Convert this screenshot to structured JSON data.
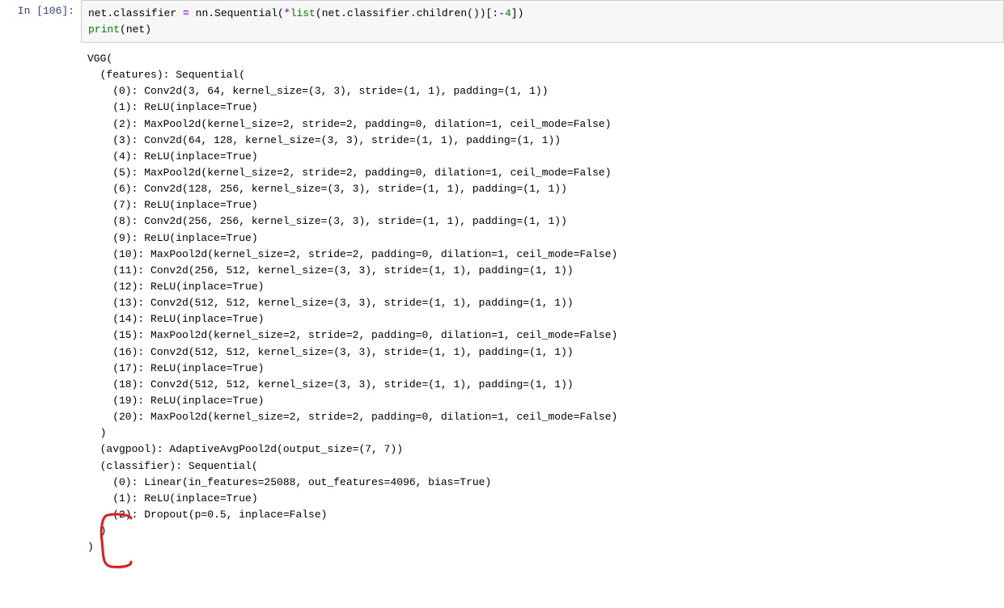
{
  "prompt": {
    "label": "In ",
    "number": "[106]:"
  },
  "code": {
    "line1": {
      "p1": "net.classifier ",
      "op": "=",
      "p2": " nn.Sequential(",
      "star": "*",
      "call": "list",
      "p3": "(net.classifier.children())[:",
      "neg": "-",
      "num": "4",
      "p4": "])"
    },
    "line2": {
      "fn": "print",
      "arg": "(net)"
    }
  },
  "output_lines": [
    "VGG(",
    "  (features): Sequential(",
    "    (0): Conv2d(3, 64, kernel_size=(3, 3), stride=(1, 1), padding=(1, 1))",
    "    (1): ReLU(inplace=True)",
    "    (2): MaxPool2d(kernel_size=2, stride=2, padding=0, dilation=1, ceil_mode=False)",
    "    (3): Conv2d(64, 128, kernel_size=(3, 3), stride=(1, 1), padding=(1, 1))",
    "    (4): ReLU(inplace=True)",
    "    (5): MaxPool2d(kernel_size=2, stride=2, padding=0, dilation=1, ceil_mode=False)",
    "    (6): Conv2d(128, 256, kernel_size=(3, 3), stride=(1, 1), padding=(1, 1))",
    "    (7): ReLU(inplace=True)",
    "    (8): Conv2d(256, 256, kernel_size=(3, 3), stride=(1, 1), padding=(1, 1))",
    "    (9): ReLU(inplace=True)",
    "    (10): MaxPool2d(kernel_size=2, stride=2, padding=0, dilation=1, ceil_mode=False)",
    "    (11): Conv2d(256, 512, kernel_size=(3, 3), stride=(1, 1), padding=(1, 1))",
    "    (12): ReLU(inplace=True)",
    "    (13): Conv2d(512, 512, kernel_size=(3, 3), stride=(1, 1), padding=(1, 1))",
    "    (14): ReLU(inplace=True)",
    "    (15): MaxPool2d(kernel_size=2, stride=2, padding=0, dilation=1, ceil_mode=False)",
    "    (16): Conv2d(512, 512, kernel_size=(3, 3), stride=(1, 1), padding=(1, 1))",
    "    (17): ReLU(inplace=True)",
    "    (18): Conv2d(512, 512, kernel_size=(3, 3), stride=(1, 1), padding=(1, 1))",
    "    (19): ReLU(inplace=True)",
    "    (20): MaxPool2d(kernel_size=2, stride=2, padding=0, dilation=1, ceil_mode=False)",
    "  )",
    "  (avgpool): AdaptiveAvgPool2d(output_size=(7, 7))",
    "  (classifier): Sequential(",
    "    (0): Linear(in_features=25088, out_features=4096, bias=True)",
    "    (1): ReLU(inplace=True)",
    "    (2): Dropout(p=0.5, inplace=False)",
    "  )",
    ")"
  ]
}
